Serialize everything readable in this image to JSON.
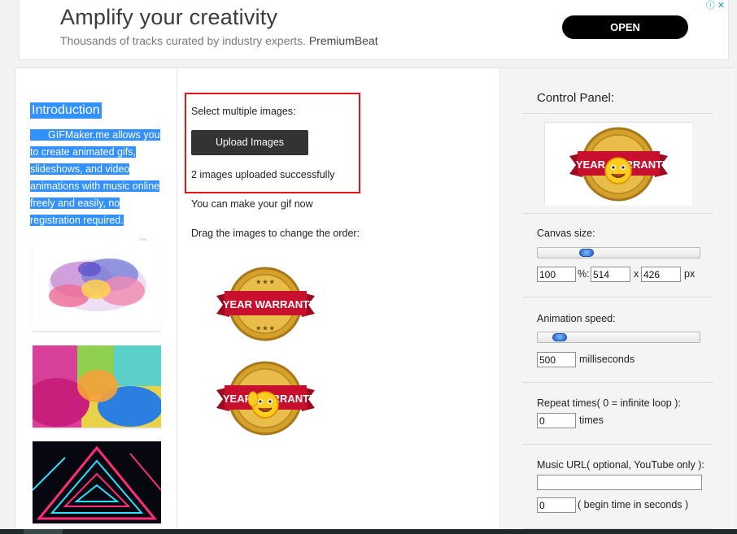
{
  "ad": {
    "title": "Amplify your creativity",
    "subtitle": "Thousands of tracks curated by industry experts.",
    "brand": "PremiumBeat",
    "cta": "OPEN",
    "info_icon": "info-icon",
    "close_icon": "close-icon"
  },
  "intro": {
    "title": "Introduction",
    "lines": [
      "GIFMaker.me allows you",
      "to create animated gifs,",
      "slideshows, and video",
      "animations with music online",
      "freely and easily, no",
      "registration required."
    ]
  },
  "upload": {
    "label": "Select multiple images:",
    "button": "Upload Images",
    "status": "2 images uploaded successfully",
    "make_now": "You can make your gif now",
    "drag_hint": "Drag the images to change the order:"
  },
  "images": [
    {
      "line1": "1 YEAR WARRANTY",
      "has_emoji": false
    },
    {
      "line1": "1 YEAR WARRANTY",
      "has_emoji": true
    }
  ],
  "control_panel": {
    "title": "Control Panel:",
    "canvas_size_label": "Canvas size:",
    "canvas_percent": "100",
    "percent_unit": "%:",
    "width": "514",
    "by": "x",
    "height": "426",
    "px_unit": "px",
    "canvas_slider_level": 0.28,
    "animation_speed_label": "Animation speed:",
    "speed_value": "500",
    "speed_unit": "milliseconds",
    "speed_slider_level": 0.1,
    "repeat_label": "Repeat times( 0 = infinite loop ):",
    "repeat_value": "0",
    "repeat_unit": "times",
    "music_label": "Music URL( optional, YouTube only ):",
    "music_value": "",
    "begin_value": "0",
    "begin_unit": "( begin time in seconds )"
  },
  "colors": {
    "highlight": "#3390ff",
    "upload_box_border": "#e0161b",
    "button_bg": "#333333",
    "ad_cta_bg": "#000000",
    "badge_red": "#c8102e",
    "badge_gold": "#d4a12a"
  }
}
